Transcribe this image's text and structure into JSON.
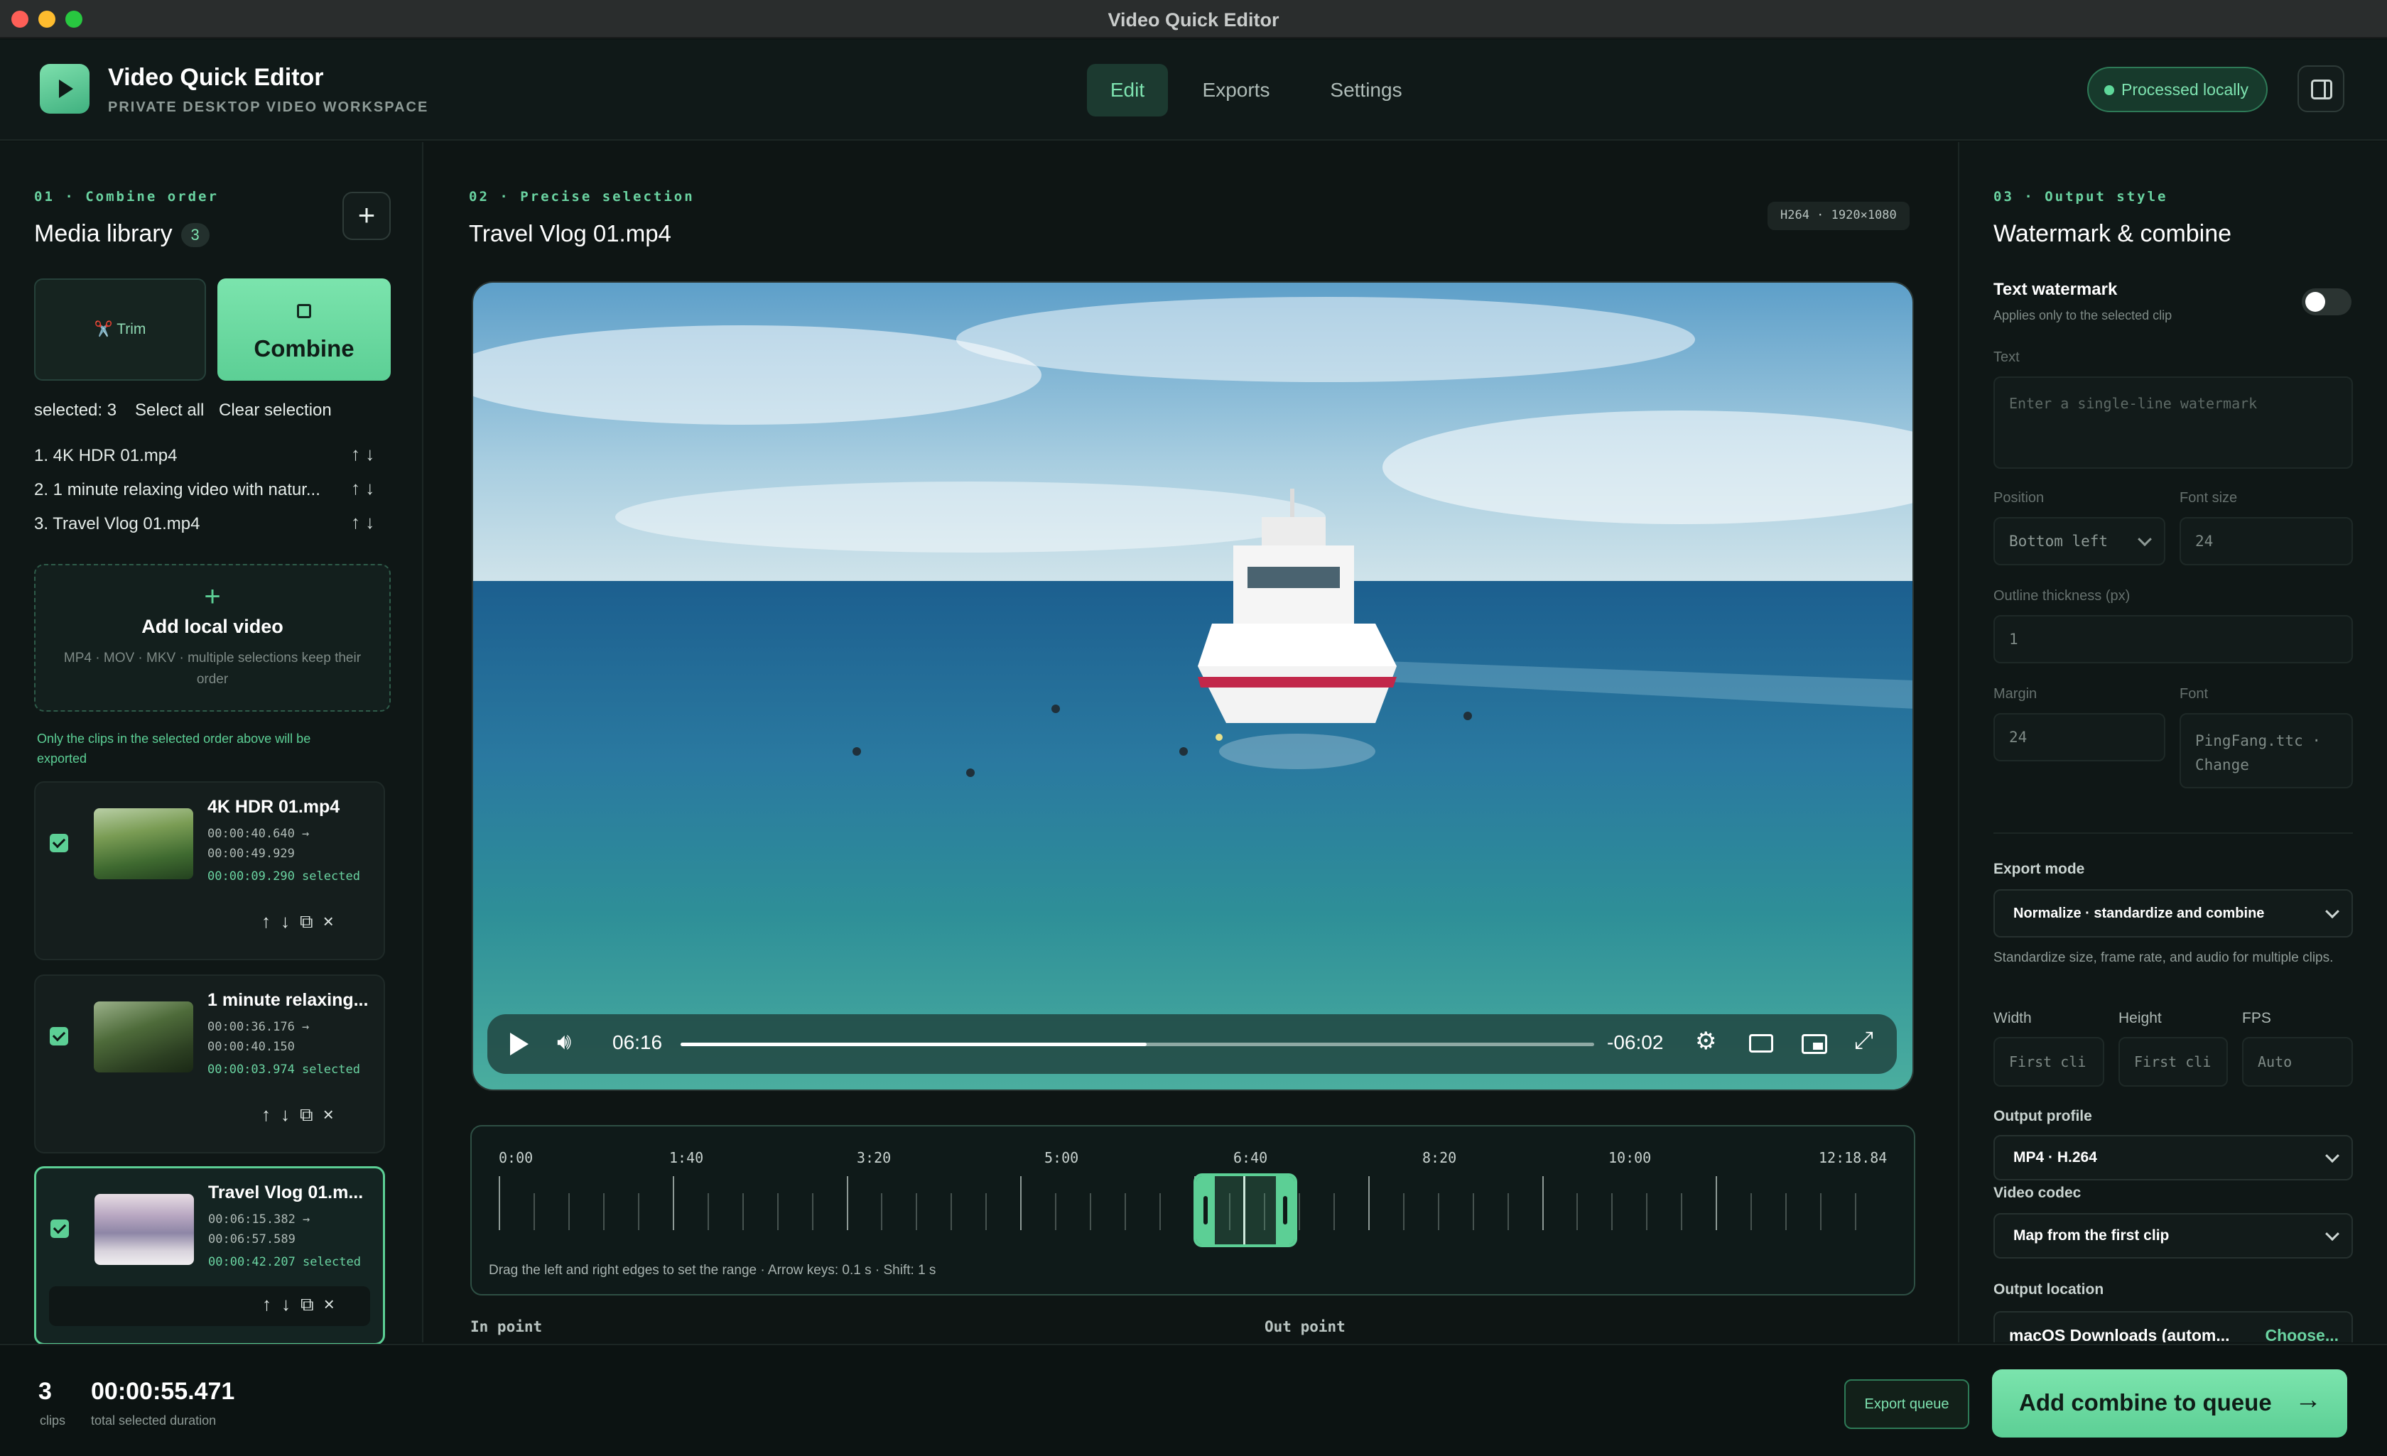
{
  "window": {
    "title": "Video Quick Editor"
  },
  "header": {
    "app_name": "Video Quick Editor",
    "app_subtitle": "PRIVATE DESKTOP VIDEO WORKSPACE",
    "tabs": [
      {
        "label": "Edit",
        "active": true
      },
      {
        "label": "Exports",
        "active": false
      },
      {
        "label": "Settings",
        "active": false
      }
    ],
    "status_badge": "Processed locally"
  },
  "left": {
    "section": "01 · Combine order",
    "title": "Media library",
    "count": "3",
    "trim_label": "✂️ Trim",
    "combine_label": "Combine",
    "selected_text": "selected: 3",
    "select_all": "Select all",
    "clear_selection": "Clear selection",
    "order": [
      "1. 4K HDR 01.mp4",
      "2. 1 minute relaxing video with natur...",
      "3. Travel Vlog 01.mp4"
    ],
    "add_title": "Add local video",
    "add_desc": "MP4 · MOV · MKV · multiple selections keep their order",
    "note": "Only the clips in the selected order above will be exported",
    "clips": [
      {
        "name": "4K HDR 01.mp4",
        "start": "00:00:40.640 →",
        "end": "00:00:49.929",
        "selected": "00:00:09.290 selected"
      },
      {
        "name": "1 minute relaxing...",
        "start": "00:00:36.176 →",
        "end": "00:00:40.150",
        "selected": "00:00:03.974 selected"
      },
      {
        "name": "Travel Vlog 01.m...",
        "start": "00:06:15.382 →",
        "end": "00:06:57.589",
        "selected": "00:00:42.207 selected"
      }
    ]
  },
  "center": {
    "section": "02 · Precise selection",
    "title": "Travel Vlog 01.mp4",
    "meta_badge": "H264 · 1920×1080",
    "player": {
      "current": "06:16",
      "remaining": "-06:02",
      "progress": 0.51
    },
    "timeline": {
      "ticks": [
        "0:00",
        "1:40",
        "3:20",
        "5:00",
        "6:40",
        "8:20",
        "10:00",
        "12:18.84"
      ],
      "hint": "Drag the left and right edges to set the range · Arrow keys: 0.1 s · Shift: 1 s"
    },
    "in_point": "In point",
    "out_point": "Out point"
  },
  "right": {
    "section": "03 · Output style",
    "title": "Watermark & combine",
    "watermark_title": "Text watermark",
    "watermark_sub": "Applies only to the selected clip",
    "text_label": "Text",
    "text_placeholder": "Enter a single-line watermark",
    "position_label": "Position",
    "position_value": "Bottom left",
    "font_size_label": "Font size",
    "font_size_value": "24",
    "outline_label": "Outline thickness (px)",
    "outline_value": "1",
    "margin_label": "Margin",
    "margin_value": "24",
    "font_label": "Font",
    "font_value": "PingFang.ttc · Change",
    "export_mode_label": "Export mode",
    "export_mode_value": "Normalize · standardize and combine",
    "export_mode_desc": "Standardize size, frame rate, and audio for multiple clips.",
    "width_label": "Width",
    "width_value": "First cli",
    "height_label": "Height",
    "height_value": "First cli",
    "fps_label": "FPS",
    "fps_value": "Auto",
    "profile_label": "Output profile",
    "profile_value": "MP4 · H.264",
    "codec_label": "Video codec",
    "codec_value": "Map from the first clip",
    "location_label": "Output location",
    "location_value": "macOS Downloads (autom...",
    "location_choose": "Choose..."
  },
  "footer": {
    "clips_count": "3",
    "clips_label": "clips",
    "duration": "00:00:55.471",
    "duration_label": "total selected duration",
    "export_queue": "Export queue",
    "add_queue": "Add combine to queue"
  },
  "colors": {
    "accent": "#5ccf95",
    "background": "#0e1514"
  }
}
